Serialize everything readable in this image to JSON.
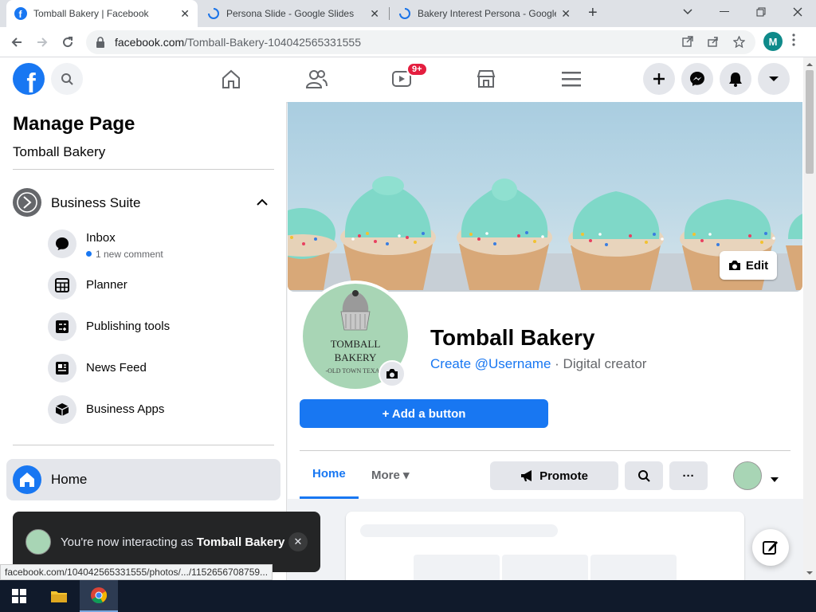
{
  "browser": {
    "tabs": [
      {
        "title": "Tomball Bakery | Facebook"
      },
      {
        "title": "Persona Slide - Google Slides"
      },
      {
        "title": "Bakery Interest Persona - Google"
      }
    ],
    "url_host": "facebook.com",
    "url_path": "/Tomball-Bakery-104042565331555",
    "profile_initial": "M",
    "status_url": "facebook.com/104042565331555/photos/.../1152656708759..."
  },
  "fb_nav": {
    "logo_letter": "f",
    "watch_badge": "9+"
  },
  "sidebar": {
    "title": "Manage Page",
    "page_name": "Tomball Bakery",
    "business_suite": "Business Suite",
    "items": [
      {
        "label": "Inbox",
        "note": "1 new comment"
      },
      {
        "label": "Planner"
      },
      {
        "label": "Publishing tools"
      },
      {
        "label": "News Feed"
      },
      {
        "label": "Business Apps"
      }
    ],
    "home_label": "Home"
  },
  "toast": {
    "prefix": "You're now interacting as",
    "name": "Tomball Bakery",
    "close": "✕"
  },
  "profile": {
    "edit_label": "Edit",
    "name": "Tomball Bakery",
    "username_link": "Create @Username",
    "category": "· Digital creator",
    "add_button": "+ Add a button",
    "logo_line1": "TOMBALL",
    "logo_line2": "BAKERY",
    "logo_line3": "-OLD TOWN TEXAS-"
  },
  "page_tabs": {
    "home": "Home",
    "more": "More ▾",
    "promote": "Promote",
    "ellipsis": "···"
  },
  "colors": {
    "fb_blue": "#1877f2",
    "badge_red": "#e41e3f",
    "logo_mint": "#a8d5b5",
    "frosting": "#7fd8c8"
  },
  "icons": [
    "home-icon",
    "friends-icon",
    "watch-icon",
    "marketplace-icon",
    "menu-icon",
    "plus-icon",
    "messenger-icon",
    "notifications-icon",
    "caret-icon",
    "camera-icon",
    "search-icon",
    "megaphone-icon",
    "compose-icon"
  ]
}
